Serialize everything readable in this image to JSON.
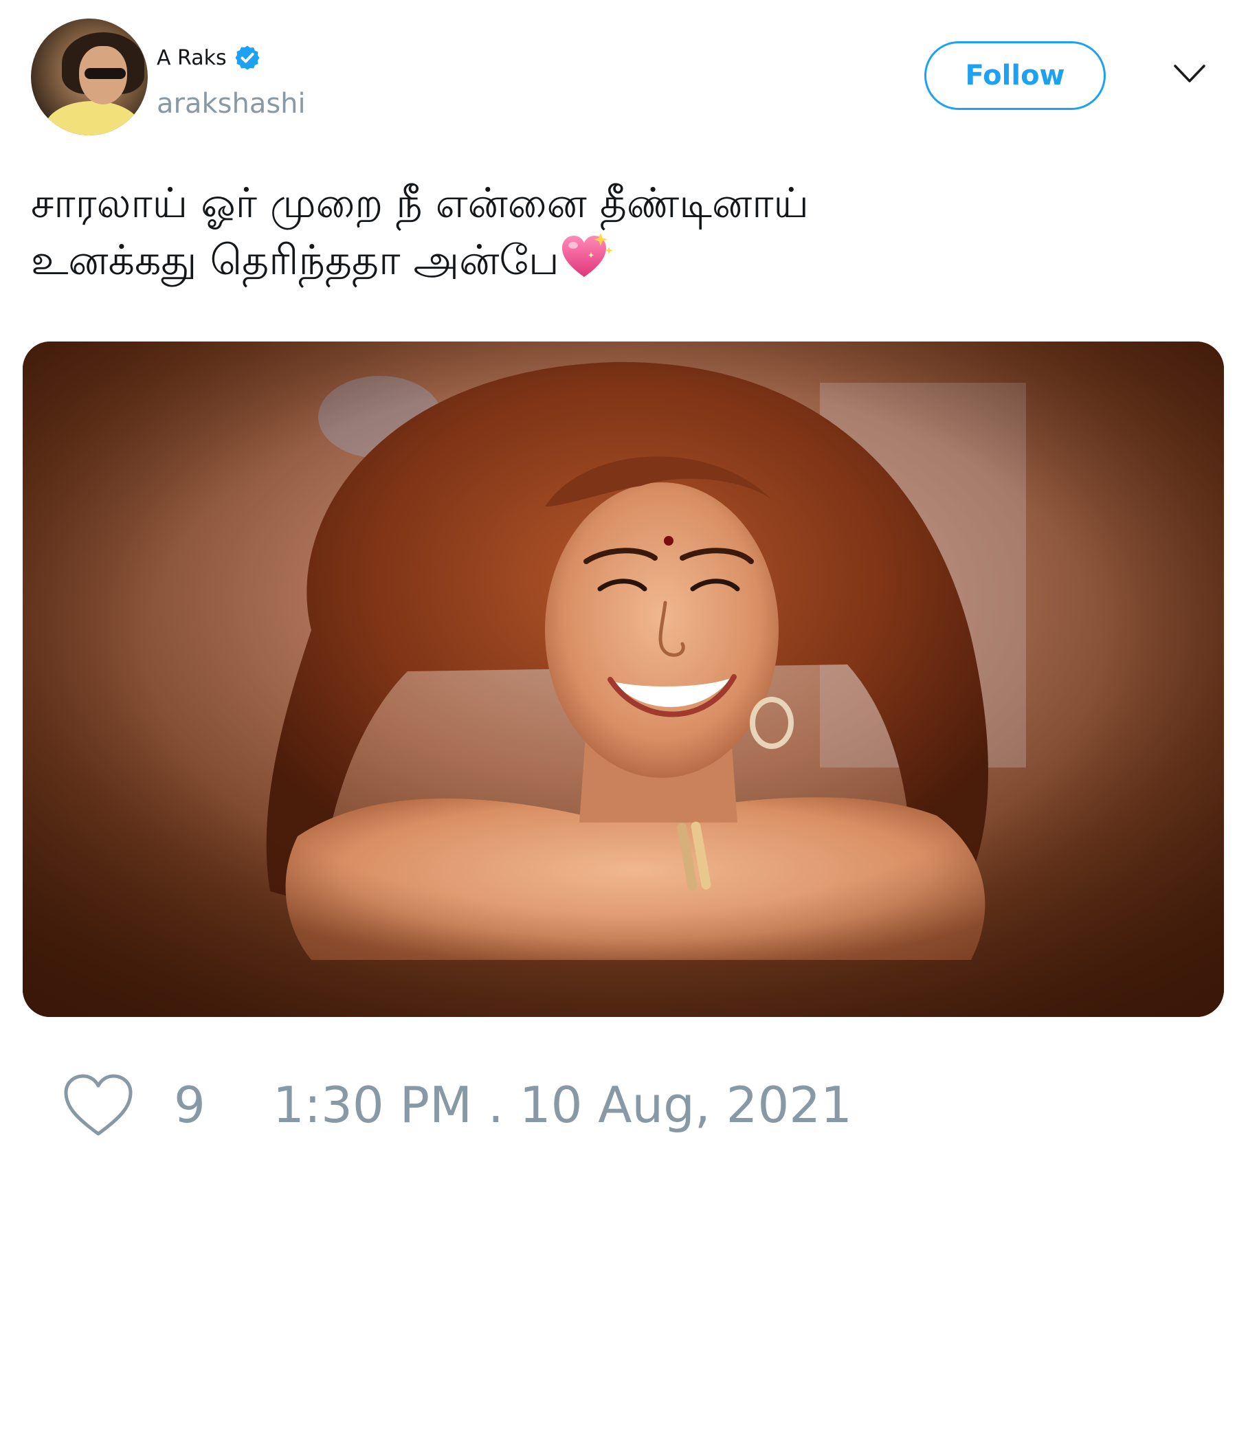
{
  "author": {
    "display_name": "A Raks",
    "handle": "arakshashi",
    "verified": true
  },
  "actions": {
    "follow_label": "Follow",
    "more_icon": "chevron-down-icon"
  },
  "tweet": {
    "text_line_1": "சாரலாய் ஓர் முறை நீ என்னை தீண்டினாய்",
    "text_line_2": "உனக்கது தெரிந்ததா அன்பே",
    "emoji": "sparkling-heart"
  },
  "media": {
    "type": "photo"
  },
  "footer": {
    "like_count": "9",
    "timestamp": "1:30 PM . 10 Aug, 2021"
  },
  "colors": {
    "accent": "#1da1f2",
    "muted": "#8899a6",
    "text": "#14171a"
  }
}
